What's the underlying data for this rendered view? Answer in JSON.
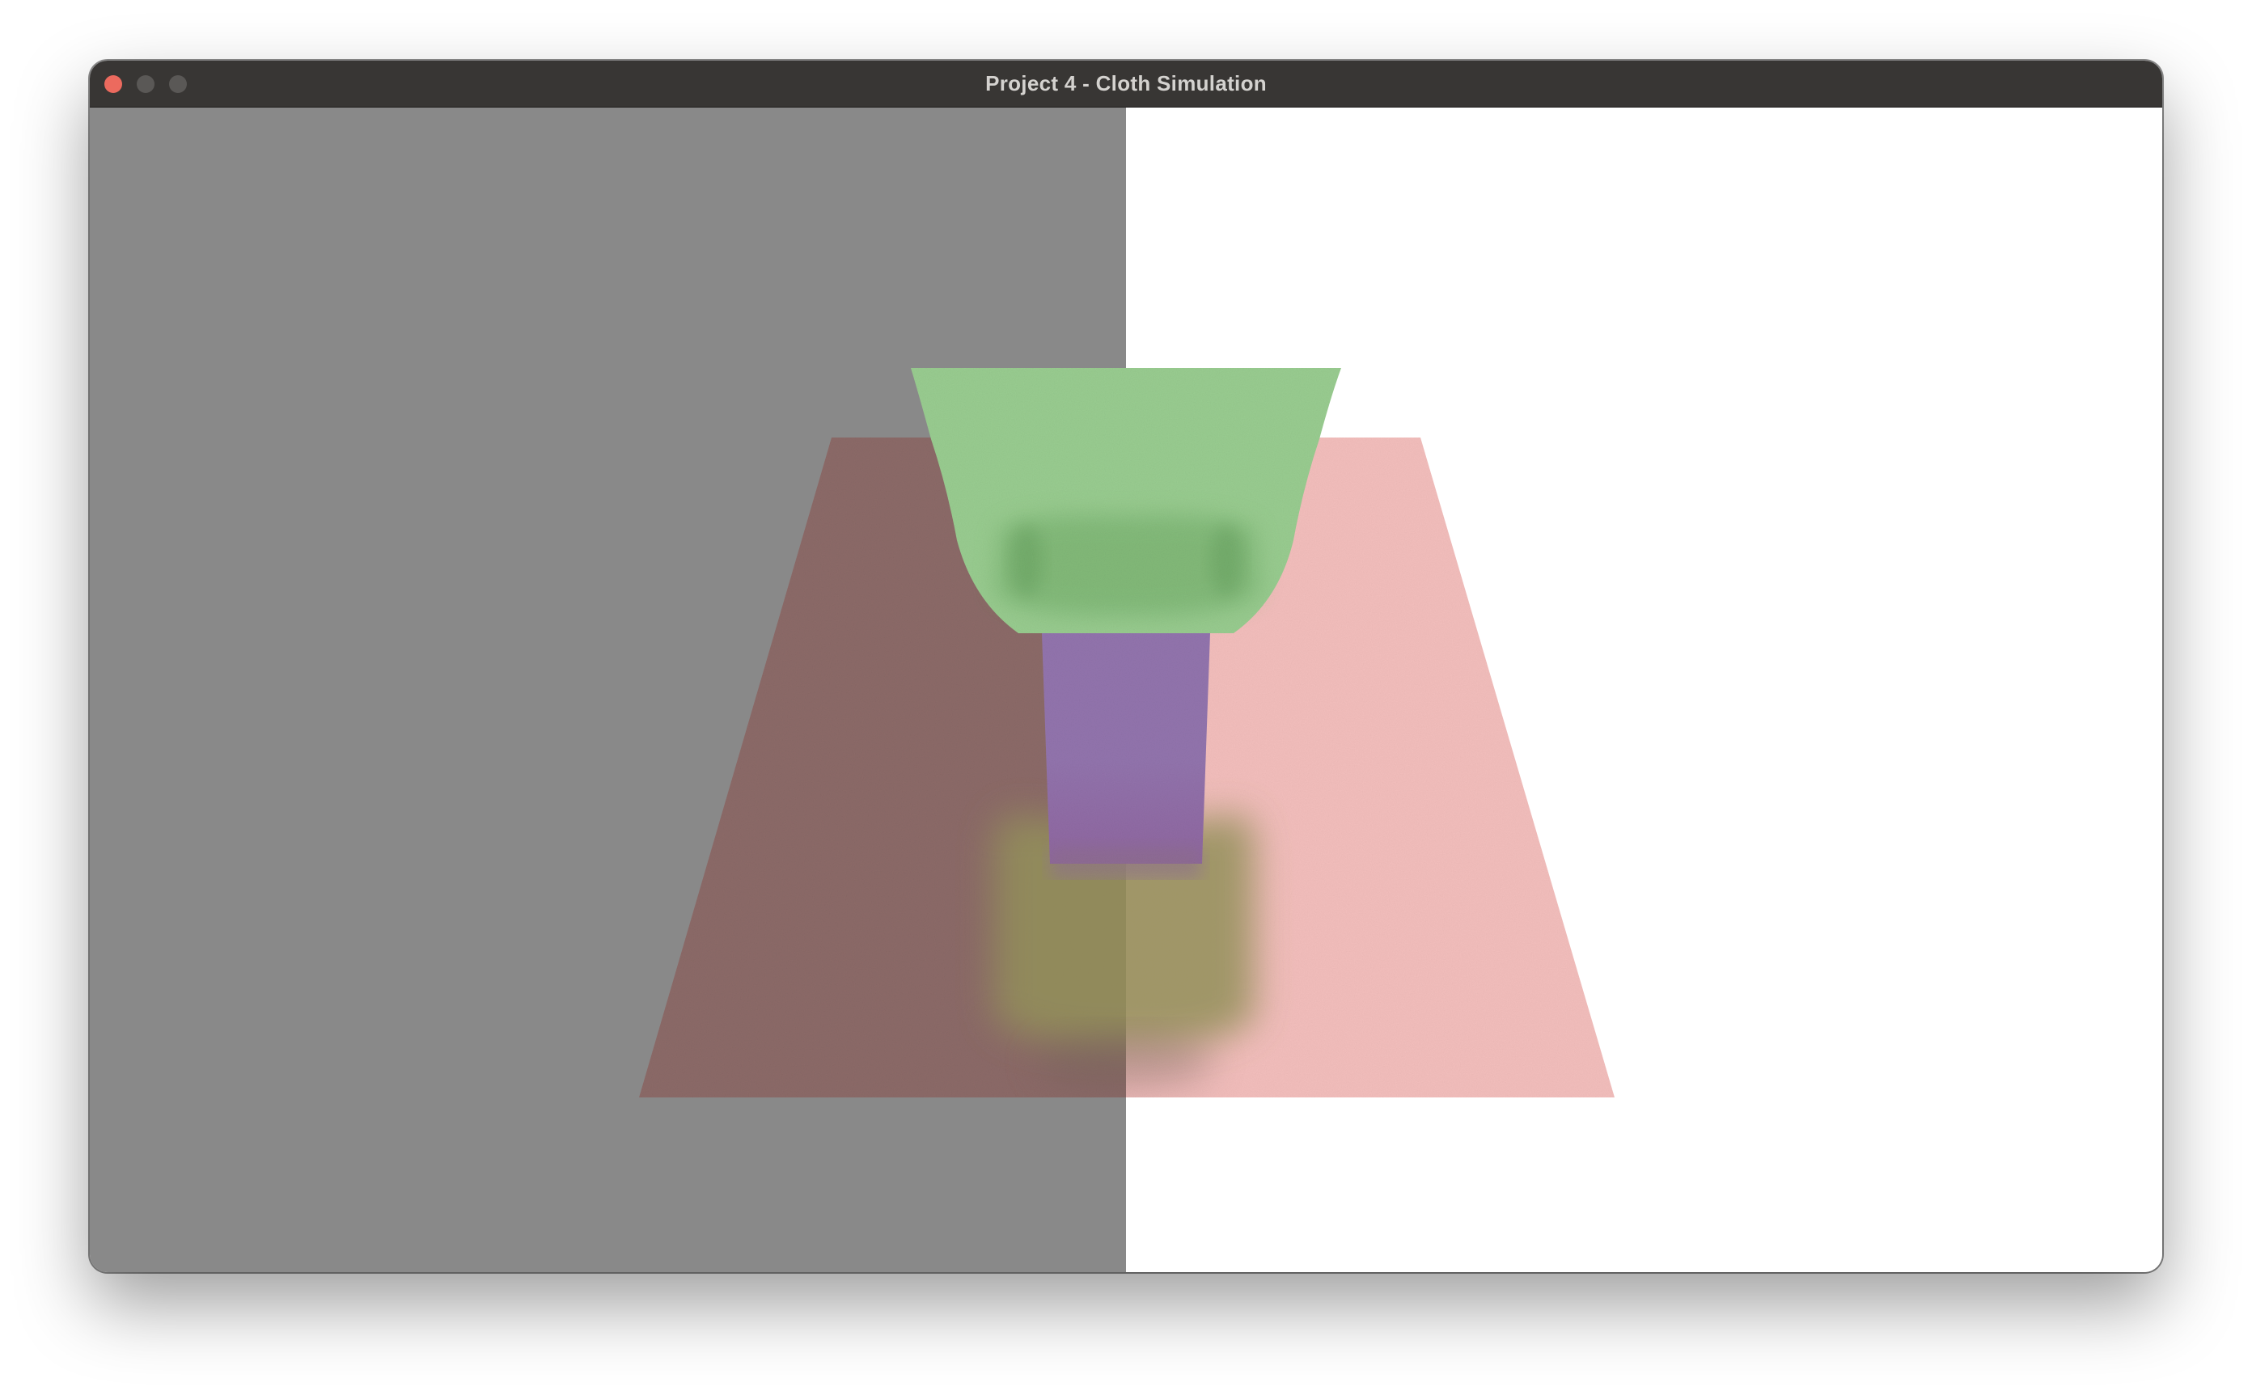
{
  "window": {
    "title": "Project 4 - Cloth Simulation",
    "controls": {
      "close_color": "#ec6a5e",
      "minimize_color": "#5a5856",
      "zoom_color": "#5a5856"
    }
  },
  "scene": {
    "colors": {
      "background_left": "#898989",
      "background_right": "#ffffff",
      "floor_shadowed": "#8c6a68",
      "floor_lit": "#f3bebc",
      "cloth": "#99cc90",
      "cloth_fold": "#6faa66",
      "pillar": "#9274ad",
      "pillar_lower": "#8f66a0",
      "reflection": "#93905a"
    }
  }
}
